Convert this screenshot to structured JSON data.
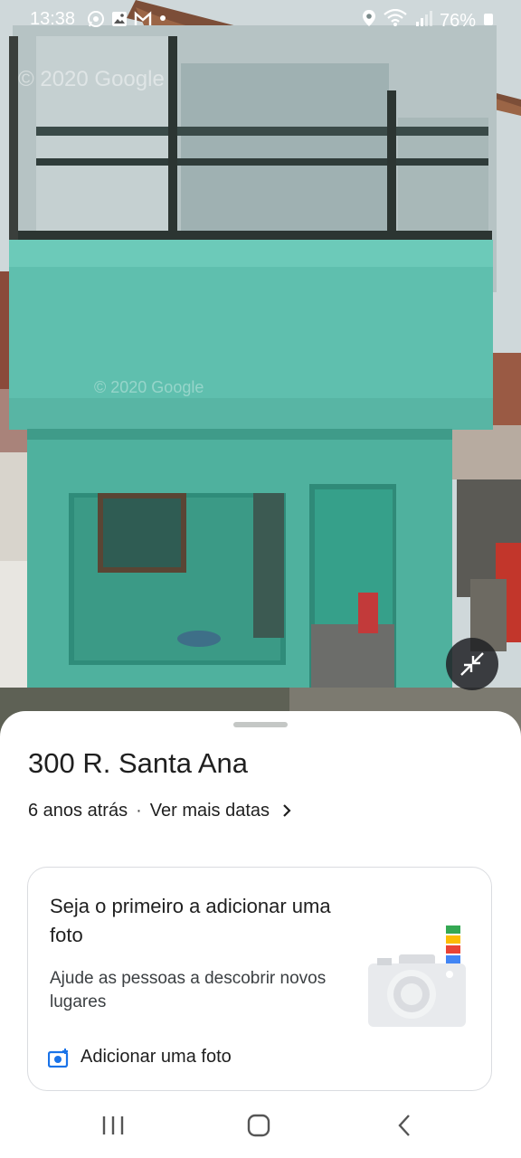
{
  "status_bar": {
    "time": "13:38",
    "battery": "76%",
    "icons": [
      "whatsapp-icon",
      "gallery-icon",
      "gmail-icon",
      "dot-icon",
      "location-icon",
      "wifi-icon",
      "signal-icon",
      "battery-icon"
    ]
  },
  "street_view": {
    "watermark_1": "© 2020 Google",
    "watermark_2": "© 2020 Google",
    "exit_fullscreen_icon": "collapse-arrows-icon"
  },
  "sheet": {
    "title": "300 R. Santa Ana",
    "age": "6 anos atrás",
    "separator": "·",
    "more_dates": "Ver mais datas",
    "card": {
      "title": "Seja o primeiro a adicionar uma foto",
      "subtitle": "Ajude as pessoas a descobrir novos lugares",
      "action": "Adicionar uma foto",
      "colors": [
        "#34a853",
        "#fbbc04",
        "#ea4335",
        "#4285f4"
      ]
    }
  },
  "nav_bar": {
    "icons": [
      "recent-apps-icon",
      "home-icon",
      "back-icon"
    ]
  }
}
